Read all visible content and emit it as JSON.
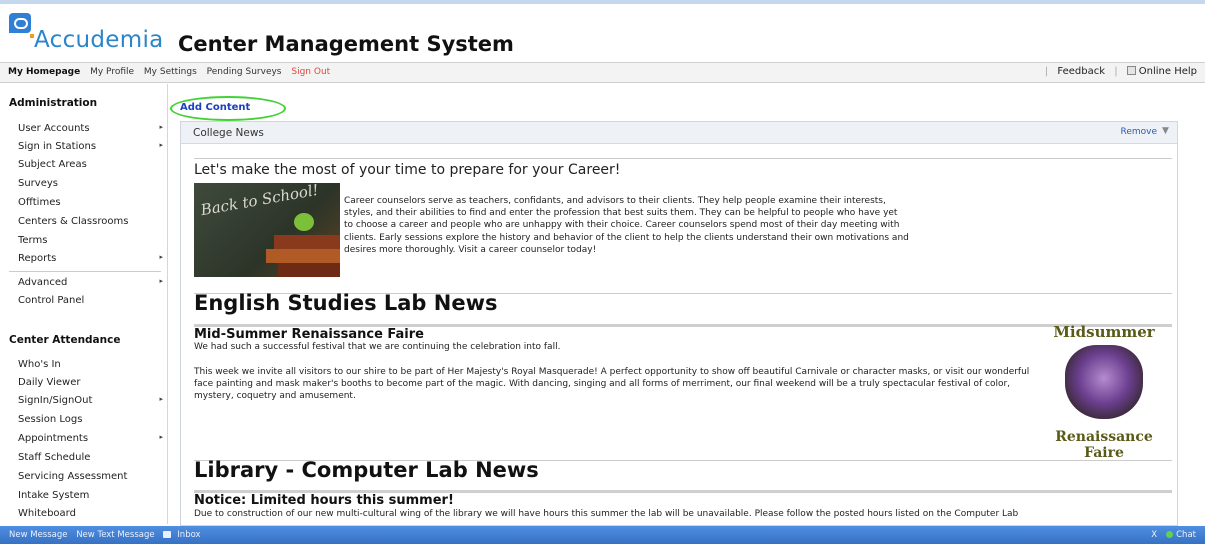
{
  "header": {
    "brand": "Accudemia",
    "app_name": "Center Management System"
  },
  "nav": {
    "items": [
      "My Homepage",
      "My Profile",
      "My Settings",
      "Pending Surveys"
    ],
    "signout": "Sign Out",
    "feedback": "Feedback",
    "help": "Online Help"
  },
  "sidebar": {
    "admin_heading": "Administration",
    "admin_items": [
      {
        "label": "User Accounts",
        "has_submenu": true
      },
      {
        "label": "Sign in Stations",
        "has_submenu": true
      },
      {
        "label": "Subject Areas",
        "has_submenu": false
      },
      {
        "label": "Surveys",
        "has_submenu": false
      },
      {
        "label": "Offtimes",
        "has_submenu": false
      },
      {
        "label": "Centers & Classrooms",
        "has_submenu": false
      },
      {
        "label": "Terms",
        "has_submenu": false
      },
      {
        "label": "Reports",
        "has_submenu": true
      }
    ],
    "advanced_items": [
      {
        "label": "Advanced",
        "has_submenu": true
      },
      {
        "label": "Control Panel",
        "has_submenu": false
      }
    ],
    "attendance_heading": "Center Attendance",
    "attendance_items": [
      {
        "label": "Who's In",
        "has_submenu": false
      },
      {
        "label": "Daily Viewer",
        "has_submenu": false
      },
      {
        "label": "SignIn/SignOut",
        "has_submenu": true
      },
      {
        "label": "Session Logs",
        "has_submenu": false
      },
      {
        "label": "Appointments",
        "has_submenu": true
      },
      {
        "label": "Staff Schedule",
        "has_submenu": false
      },
      {
        "label": "Servicing Assessment",
        "has_submenu": false
      },
      {
        "label": "Intake System",
        "has_submenu": false
      },
      {
        "label": "Whiteboard",
        "has_submenu": false
      }
    ],
    "arrow": "▸"
  },
  "main": {
    "add_content": "Add Content",
    "widget_title": "College News",
    "remove": "Remove",
    "menu_glyph": "▼",
    "career": {
      "heading": "Let's make the most of your time to prepare for your Career!",
      "image_text": "Back to School!",
      "body": "Career counselors serve as teachers, confidants, and advisors to their clients. They help people examine their interests, styles, and their abilities to find and enter the profession that best suits them. They can be helpful to people who have yet to choose a career and people who are unhappy with their choice. Career counselors spend most of their day meeting with clients. Early sessions explore the history and behavior of the client to help the clients understand their own motivations and desires more thoroughly. Visit a career counselor today!"
    },
    "english": {
      "heading": "English Studies Lab News",
      "sub": "Mid-Summer Renaissance Faire",
      "p1": "We had such a successful festival that we are continuing the celebration into fall.",
      "p2": "This week we invite all visitors to our shire to be part of Her Majesty's Royal Masquerade! A perfect opportunity to show off beautiful Carnivale or character masks, or visit our wonderful face painting and mask maker's booths to become part of the magic. With dancing, singing and all forms of merriment, our final weekend will be a truly spectacular festival of color, mystery, coquetry and amusement.",
      "faire_top": "Midsummer",
      "faire_bottom": "Renaissance Faire"
    },
    "library": {
      "heading": "Library - Computer Lab News",
      "sub": "Notice: Limited hours this summer!",
      "p1": "Due to construction of our new multi-cultural wing of the library we will have hours this summer the lab will be unavailable.  Please follow the posted hours listed on the Computer Lab"
    }
  },
  "bottombar": {
    "new_message": "New Message",
    "new_text": "New Text Message",
    "inbox": "Inbox",
    "x": "X",
    "chat": "Chat"
  }
}
